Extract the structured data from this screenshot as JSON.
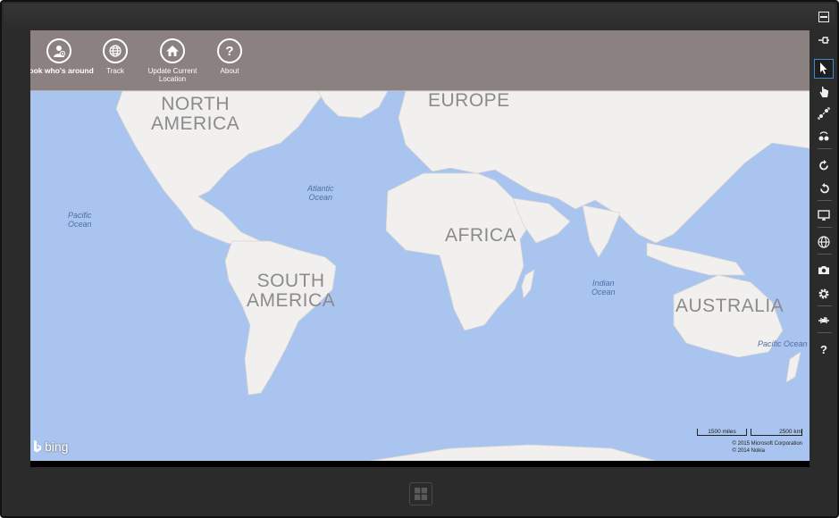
{
  "appbar": {
    "buttons": [
      {
        "label": "Look who's around",
        "icon": "person-icon",
        "active": true
      },
      {
        "label": "Track",
        "icon": "globe-icon",
        "active": false
      },
      {
        "label": "Update Current Location",
        "icon": "home-icon",
        "active": false
      },
      {
        "label": "About",
        "icon": "question-icon",
        "active": false,
        "glyph": "?"
      }
    ]
  },
  "map": {
    "continents": {
      "north_america": "NORTH\nAMERICA",
      "europe": "EUROPE",
      "africa": "AFRICA",
      "south_america": "SOUTH\nAMERICA",
      "australia": "AUSTRALIA"
    },
    "oceans": {
      "pacific_west": "Pacific\nOcean",
      "atlantic": "Atlantic\nOcean",
      "indian": "Indian\nOcean",
      "pacific_east": "Pacific Ocean"
    },
    "provider": "bing",
    "scale": {
      "miles": "1500 miles",
      "km": "2500 km"
    },
    "copyright": [
      "© 2015 Microsoft Corporation",
      "© 2014 Nokia"
    ],
    "colors": {
      "water": "#a9c4ef",
      "land": "#f1f0ee",
      "appbar": "#8b8180"
    }
  },
  "simulator_toolbar": {
    "tools": [
      "minimize-icon",
      "pin-icon",
      "mouse-mode-icon",
      "touch-mode-icon",
      "pinch-zoom-icon",
      "rotate-touch-icon",
      "rotate-clockwise-icon",
      "rotate-counterclockwise-icon",
      "resolution-icon",
      "location-icon",
      "screenshot-icon",
      "settings-icon",
      "network-icon",
      "help-icon"
    ],
    "help_glyph": "?"
  }
}
